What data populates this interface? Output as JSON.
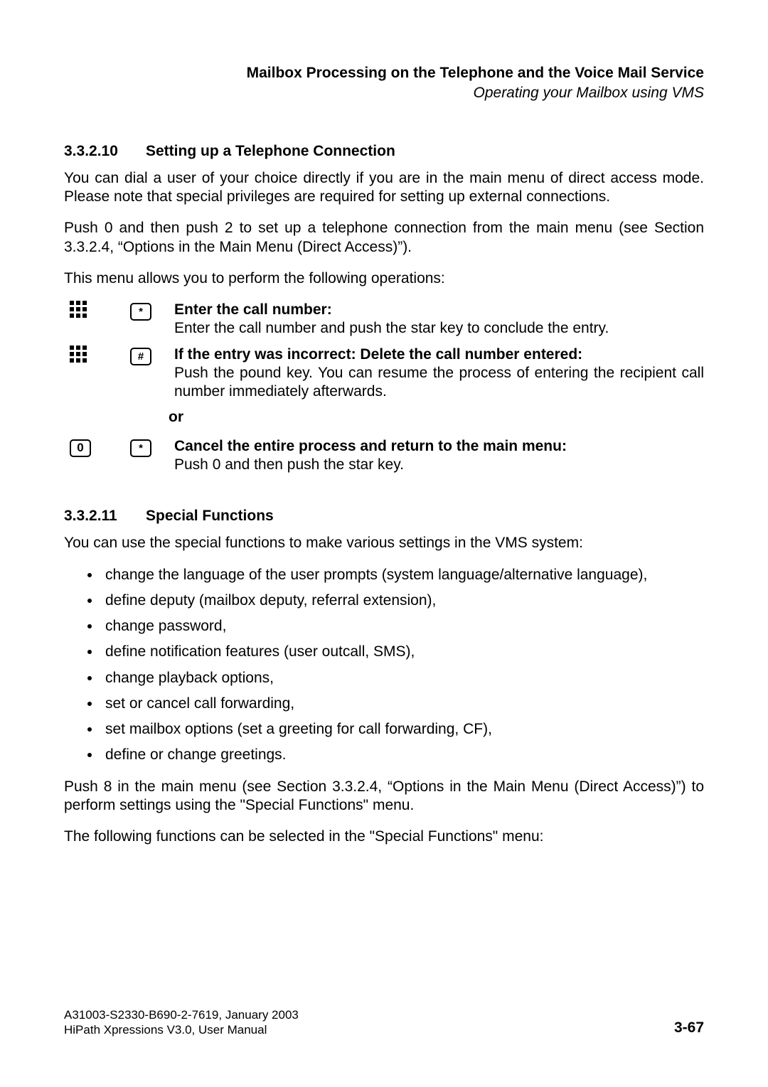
{
  "header": {
    "title": "Mailbox Processing on the Telephone and the Voice Mail Service",
    "subtitle": "Operating your Mailbox using VMS"
  },
  "section1": {
    "number": "3.3.2.10",
    "title": "Setting up a Telephone Connection",
    "p1": "You can dial a user of your choice directly if you are in the main menu of direct access mode. Please note that special privileges are required for setting up external connections.",
    "p2": "Push 0 and then push 2 to set up a telephone connection from the main menu (see Section 3.3.2.4, “Options in the Main Menu (Direct Access)”).",
    "p3": "This menu allows you to perform the following operations:",
    "steps": {
      "s1": {
        "key": "*",
        "label": "Enter the call number:",
        "body": "Enter the call number and push the star key to conclude the entry."
      },
      "s2": {
        "key": "#",
        "label": "If the entry was incorrect: Delete the call number entered:",
        "body": "Push the pound key. You can resume the process of entering the recipient call number immediately afterwards."
      },
      "or": "or",
      "s3": {
        "key1": "0",
        "key2": "*",
        "label": "Cancel the entire process and return to the main menu:",
        "body": "Push 0 and then push the star key."
      }
    }
  },
  "section2": {
    "number": "3.3.2.11",
    "title": "Special Functions",
    "p1": "You can use the special functions to make various settings in the VMS system:",
    "bullets": [
      "change the language of the user prompts (system language/alternative language),",
      "define deputy (mailbox deputy, referral extension),",
      "change password,",
      "define notification features (user outcall, SMS),",
      "change playback options,",
      "set or cancel call forwarding,",
      "set mailbox options (set a greeting for call forwarding, CF),",
      "define or change greetings."
    ],
    "p2": "Push 8 in the main menu (see Section 3.3.2.4, “Options in the Main Menu (Direct Access)”) to perform settings using the \"Special Functions\" menu.",
    "p3": "The following functions can be selected in the \"Special Functions\" menu:"
  },
  "footer": {
    "line1": "A31003-S2330-B690-2-7619, January 2003",
    "line2": "HiPath Xpressions V3.0, User Manual",
    "page": "3-67"
  }
}
